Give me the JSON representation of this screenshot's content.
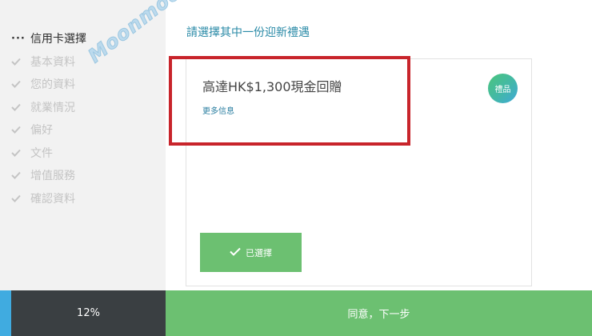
{
  "steps": [
    {
      "label": "信用卡選擇",
      "state": "active"
    },
    {
      "label": "基本資料",
      "state": "pending"
    },
    {
      "label": "您的資料",
      "state": "pending"
    },
    {
      "label": "就業情況",
      "state": "pending"
    },
    {
      "label": "偏好",
      "state": "pending"
    },
    {
      "label": "文件",
      "state": "pending"
    },
    {
      "label": "增值服務",
      "state": "pending"
    },
    {
      "label": "確認資料",
      "state": "pending"
    }
  ],
  "watermark": "Moonmoo!",
  "main": {
    "prompt": "請選擇其中一份迎新禮遇",
    "offer": {
      "title": "高達HK$1,300現金回贈",
      "more_info": "更多信息",
      "badge": "禮品",
      "selected_label": "已選擇"
    }
  },
  "footer": {
    "progress": "12%",
    "next_label": "同意，下一步"
  },
  "colors": {
    "accent_green": "#6cc071",
    "link_blue": "#2a8aa7",
    "highlight_red": "#c8242b",
    "progress_blue": "#40abe0",
    "dark_panel": "#3a3f42"
  }
}
